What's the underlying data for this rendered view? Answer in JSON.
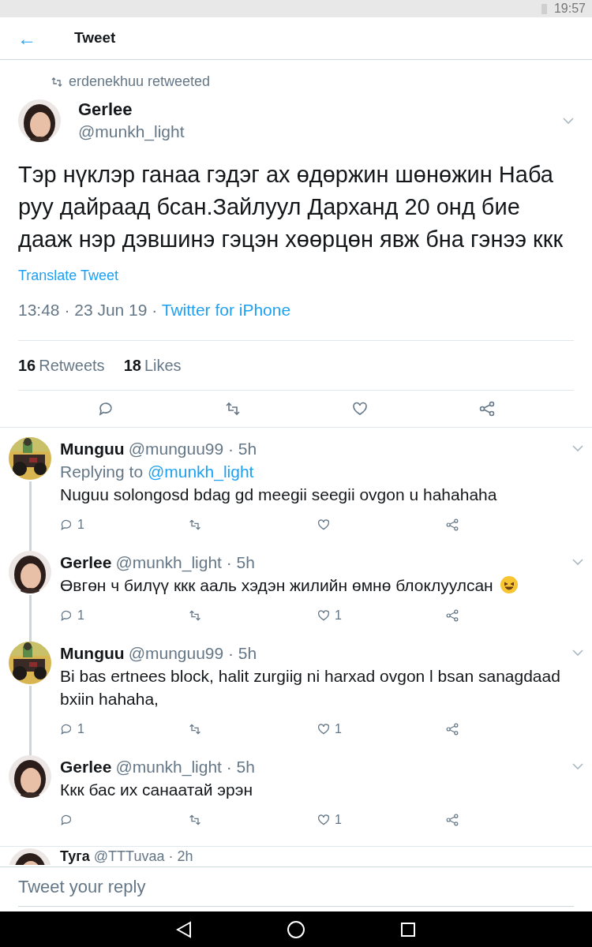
{
  "status_bar": {
    "time": "19:57"
  },
  "header": {
    "back": "←",
    "title": "Tweet"
  },
  "tweet": {
    "retweeted_by": "erdenekhuu retweeted",
    "name": "Gerlee",
    "handle": "@munkh_light",
    "text": "Тэр нүклэр ганаа гэдэг ах өдөржин шөнөжин Наба руу дайраад бсан.Зайлуул Дарханд 20 онд бие дааж нэр дэвшинэ гэцэн хөөрцөн явж бна гэнээ ккк",
    "translate": "Translate Tweet",
    "timestamp": "13:48 · 23 Jun 19 · ",
    "source": "Twitter for iPhone",
    "retweets": {
      "count": "16",
      "label": "Retweets"
    },
    "likes": {
      "count": "18",
      "label": "Likes"
    }
  },
  "replies": [
    {
      "name": "Munguu",
      "handle": "@munguu99 · 5h",
      "replying_label": "Replying to ",
      "replying_to": "@munkh_light",
      "text": "Nuguu solongosd bdag gd meegii seegii ovgon u hahahaha",
      "emoji": false,
      "reply_count": "1",
      "thread_below": true
    },
    {
      "name": "Gerlee",
      "handle": "@munkh_light · 5h",
      "text": "Өвгөн ч билүү ккк ааль хэдэн жилийн өмнө блоклуулсан",
      "emoji": true,
      "reply_count": "1",
      "like_count": "1",
      "thread_below": true
    },
    {
      "name": "Munguu",
      "handle": "@munguu99 · 5h",
      "text": "Bi bas ertnees block, halit zurgiig ni harxad ovgon l bsan sanagdaad bxiin hahaha,",
      "emoji": false,
      "reply_count": "1",
      "like_count": "1",
      "thread_below": true
    },
    {
      "name": "Gerlee",
      "handle": "@munkh_light · 5h",
      "text": "Ккк бас их санаатай эрэн",
      "emoji": false,
      "like_count": "1",
      "thread_below": false
    }
  ],
  "next_reply": {
    "name": "Туга",
    "handle": "@TTTuvaa · 2h"
  },
  "reply_box": {
    "placeholder": "Tweet your reply"
  }
}
